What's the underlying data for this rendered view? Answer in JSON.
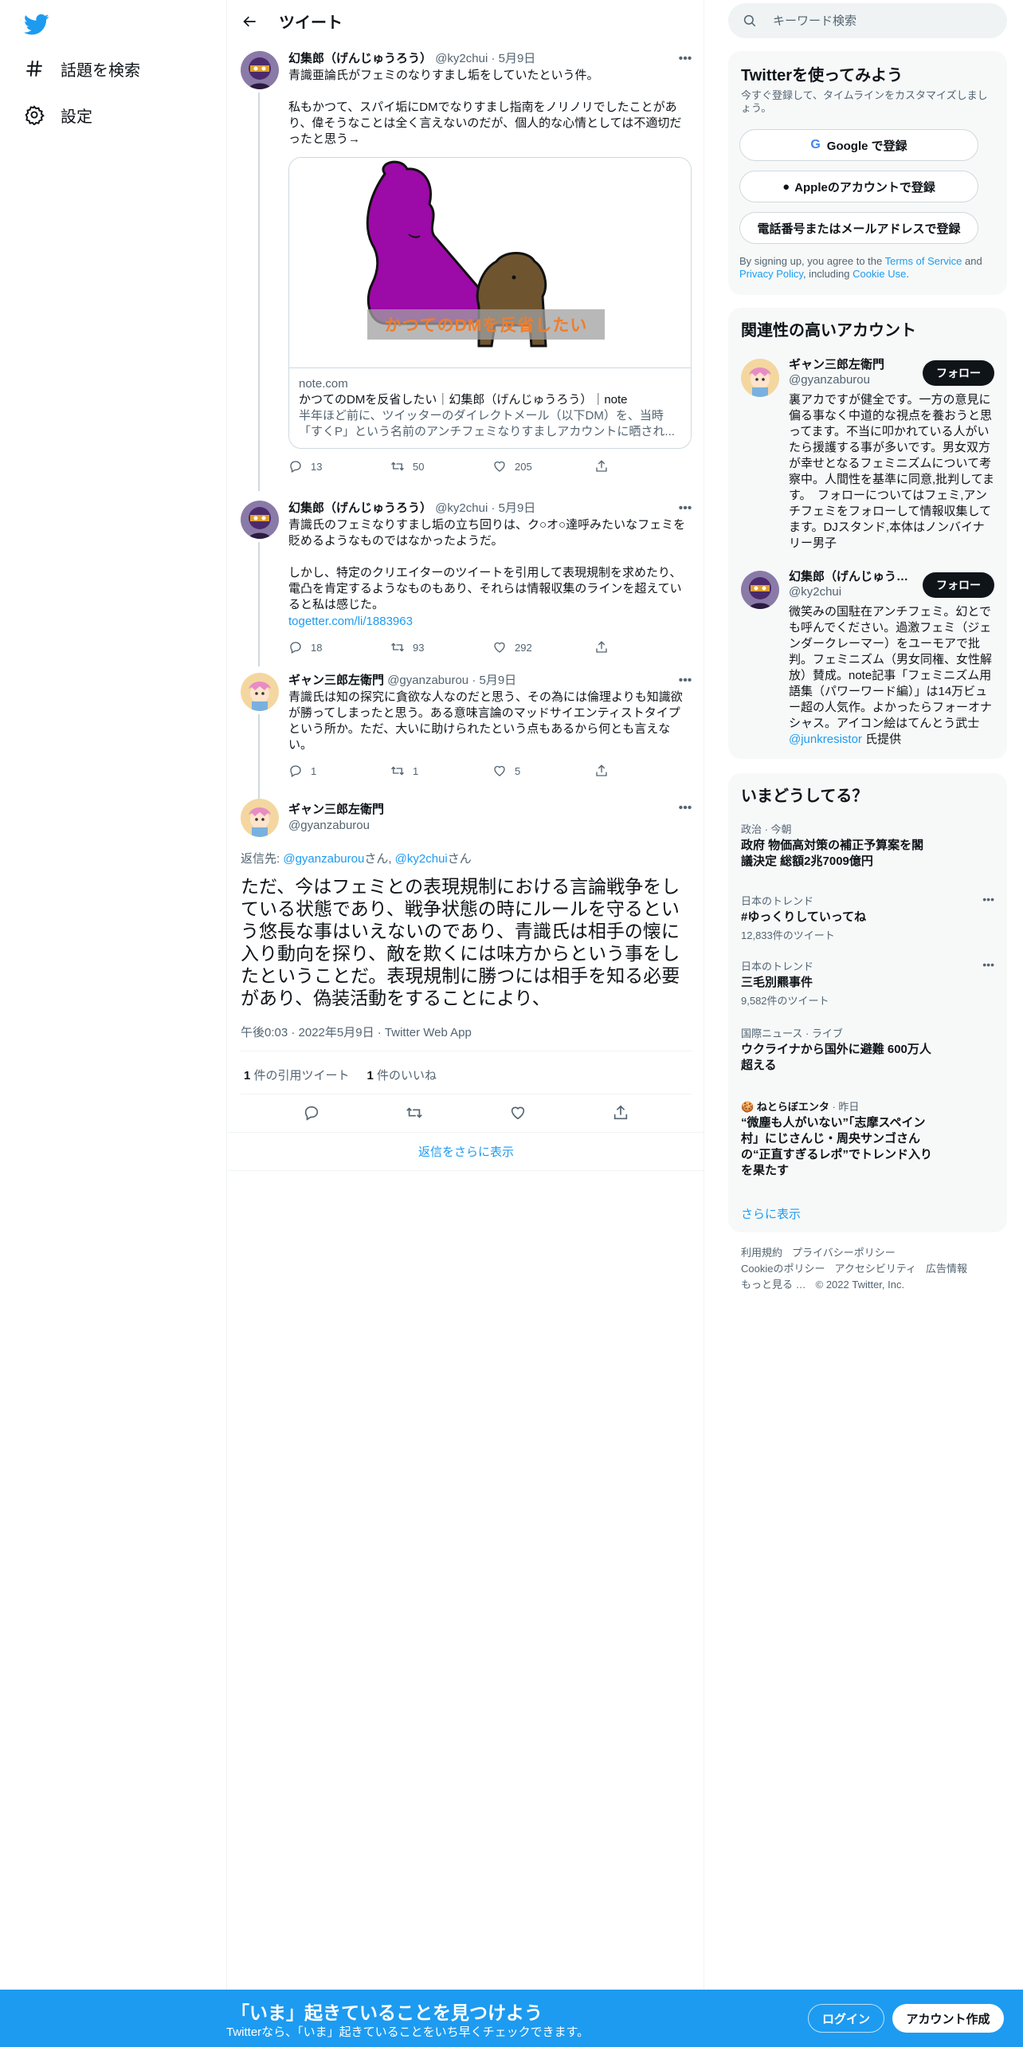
{
  "nav": {
    "explore_label": "話題を検索",
    "settings_label": "設定"
  },
  "header": {
    "title": "ツイート"
  },
  "tweets": [
    {
      "name": "幻集郎（げんじゅうろう）",
      "handle": "@ky2chui",
      "date": "5月9日",
      "text": "青識亜論氏がフェミのなりすまし垢をしていたという件。\n\n私もかつて、スパイ垢にDMでなりすまし指南をノリノリでしたことがあり、偉そうなことは全く言えないのだが、個人的な心情としては不適切だったと思う→",
      "card": {
        "image_caption": "かつてのDMを反省したい",
        "domain": "note.com",
        "title": "かつてのDMを反省したい｜幻集郎（げんじゅうろう）｜note",
        "description": "半年ほど前に、ツイッターのダイレクトメール（以下DM）を、当時「すくP」という名前のアンチフェミなりすましアカウントに晒され..."
      },
      "replies": "13",
      "retweets": "50",
      "likes": "205"
    },
    {
      "name": "幻集郎（げんじゅうろう）",
      "handle": "@ky2chui",
      "date": "5月9日",
      "text": "青識氏のフェミなりすまし垢の立ち回りは、ク○オ○達呼みたいなフェミを貶めるようなものではなかったようだ。\n\nしかし、特定のクリエイターのツイートを引用して表現規制を求めたり、電凸を肯定するようなものもあり、それらは情報収集のラインを超えていると私は感じた。",
      "link": "togetter.com/li/1883963",
      "replies": "18",
      "retweets": "93",
      "likes": "292"
    },
    {
      "name": "ギャン三郎左衛門",
      "handle": "@gyanzaburou",
      "date": "5月9日",
      "text": "青識氏は知の探究に貪欲な人なのだと思う、その為には倫理よりも知識欲が勝ってしまったと思う。ある意味言論のマッドサイエンティストタイプという所か。ただ、大いに助けられたという点もあるから何とも言えない。",
      "replies": "1",
      "retweets": "1",
      "likes": "5"
    }
  ],
  "focused": {
    "name": "ギャン三郎左衛門",
    "handle": "@gyanzaburou",
    "reply_prefix": "返信先: ",
    "reply_to_1": "@gyanzaburou",
    "reply_san_1": "さん, ",
    "reply_to_2": "@ky2chui",
    "reply_san_2": "さん",
    "text": "ただ、今はフェミとの表現規制における言論戦争をしている状態であり、戦争状態の時にルールを守るという悠長な事はいえないのであり、青識氏は相手の懐に入り動向を探り、敵を欺くには味方からという事をしたということだ。表現規制に勝つには相手を知る必要があり、偽装活動をすることにより、",
    "timestamp": "午後0:03 · 2022年5月9日 · Twitter Web App",
    "quote_count": "1",
    "quote_label": " 件の引用ツイート",
    "like_count": "1",
    "like_label": " 件のいいね",
    "show_more_replies": "返信をさらに表示"
  },
  "search": {
    "placeholder": "キーワード検索"
  },
  "signup": {
    "title": "Twitterを使ってみよう",
    "subtitle": "今すぐ登録して、タイムラインをカスタマイズしましょう。",
    "google": "Google で登録",
    "apple": "Appleのアカウントで登録",
    "phone": "電話番号またはメールアドレスで登録",
    "legal_1": "By signing up, you agree to the ",
    "terms": "Terms of Service",
    "legal_2": " and ",
    "privacy": "Privacy Policy",
    "legal_3": ", including ",
    "cookie": "Cookie Use",
    "legal_4": "."
  },
  "related": {
    "title": "関連性の高いアカウント",
    "accounts": [
      {
        "name": "ギャン三郎左衛門",
        "handle": "@gyanzaburou",
        "follow": "フォロー",
        "bio": "裏アカですが健全です。一方の意見に偏る事なく中道的な視点を養おうと思ってます。不当に叩かれている人がいたら援護する事が多いです。男女双方が幸せとなるフェミニズムについて考察中。人間性を基準に同意,批判してます。　フォローについてはフェミ,アンチフェミをフォローして情報収集してます。DJスタンド,本体はノンバイナリー男子"
      },
      {
        "name": "幻集郎（げんじゅうろう）",
        "handle": "@ky2chui",
        "follow": "フォロー",
        "bio": "微笑みの国駐在アンチフェミ。幻とでも呼んでください。過激フェミ（ジェンダークレーマー）をユーモアで批判。フェミニズム（男女同権、女性解放）賛成。note記事「フェミニズム用語集（パワーワード編）」は14万ビュー超の人気作。よかったらフォーオナシャス。アイコン絵はてんとう武士",
        "bio_link": "@junkresistor",
        "bio_suffix": " 氏提供"
      }
    ]
  },
  "trends": {
    "title": "いまどうしてる？",
    "items": [
      {
        "context": "政治 · 今朝",
        "title": "政府 物価高対策の補正予算案を閣議決定 総額2兆7009億円",
        "count": ""
      },
      {
        "context": "日本のトレンド",
        "title": "#ゆっくりしていってね",
        "count": "12,833件のツイート"
      },
      {
        "context": "日本のトレンド",
        "title": "三毛別羆事件",
        "count": "9,582件のツイート"
      },
      {
        "context": "国際ニュース · ライブ",
        "title": "ウクライナから国外に避難 600万人超える",
        "count": ""
      },
      {
        "context_source": "ねとらぼエンタ",
        "context": " · 昨日",
        "title": "“微塵も人がいない”「志摩スペイン村」にじさんじ・周央サンゴさんの“正直すぎるレポ”でトレンド入りを果たす",
        "count": ""
      }
    ],
    "show_more": "さらに表示"
  },
  "footer": {
    "links": [
      "利用規約",
      "プライバシーポリシー",
      "Cookieのポリシー",
      "アクセシビリティ",
      "広告情報",
      "もっと見る …"
    ],
    "copyright": "© 2022 Twitter, Inc."
  },
  "bottom": {
    "headline": "「いま」起きていることを見つけよう",
    "sub": "Twitterなら、「いま」起きていることをいち早くチェックできます。",
    "login": "ログイン",
    "signup": "アカウント作成"
  },
  "colors": {
    "accent": "#1d9bf0",
    "text": "#0f1419",
    "muted": "#536471",
    "border": "#eff3f4"
  }
}
